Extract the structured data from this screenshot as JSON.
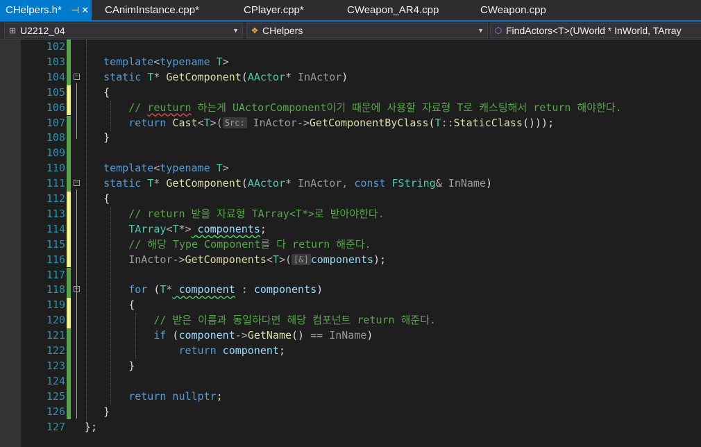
{
  "tabs": [
    {
      "label": "CHelpers.h*",
      "active": true
    },
    {
      "label": "CAnimInstance.cpp*",
      "active": false
    },
    {
      "label": "CPlayer.cpp*",
      "active": false
    },
    {
      "label": "CWeapon_AR4.cpp",
      "active": false
    },
    {
      "label": "CWeapon.cpp",
      "active": false
    }
  ],
  "nav": {
    "project": "U2212_04",
    "scope": "CHelpers",
    "member": "FindActors<T>(UWorld * InWorld, TArray"
  },
  "line_numbers": [
    "102",
    "103",
    "104",
    "105",
    "106",
    "107",
    "108",
    "109",
    "110",
    "111",
    "112",
    "113",
    "114",
    "115",
    "116",
    "117",
    "118",
    "119",
    "120",
    "121",
    "122",
    "123",
    "124",
    "125",
    "126",
    "127"
  ],
  "code": {
    "l103": {
      "kw": "template",
      "lt": "<",
      "kw2": "typename",
      "t": " T",
      "gt": ">"
    },
    "l104": {
      "kw": "static",
      "t": " T",
      "star": "*",
      "fn": " GetComponent",
      "p1": "(",
      "ty": "AActor",
      "star2": "*",
      "pm": " InActor",
      "p2": ")"
    },
    "l105": "{",
    "l106": {
      "pre": "// ",
      "squig": "reuturn",
      "rest": " 하는게 UActorComponent이기 때문에 사용할 자료형 T로 캐스팅해서 return 해야한다."
    },
    "l107": {
      "kw": "return",
      "fn": " Cast",
      "lt": "<",
      "t": "T",
      "gt": ">(",
      "hint": "Src:",
      "pm": " InActor",
      "arrow": "->",
      "fn2": "GetComponentByClass",
      "p": "(",
      "t2": "T",
      "cc": "::",
      "fn3": "StaticClass",
      "end": "()));"
    },
    "l108": "}",
    "l110": {
      "kw": "template",
      "lt": "<",
      "kw2": "typename",
      "t": " T",
      "gt": ">"
    },
    "l111": {
      "kw": "static",
      "t": " T",
      "star": "*",
      "fn": " GetComponent",
      "p1": "(",
      "ty": "AActor",
      "star2": "*",
      "pm": " InActor,",
      "kw3": " const",
      "ty2": " FString",
      "amp": "&",
      "pm2": " InName",
      "p2": ")"
    },
    "l112": "{",
    "l113": "// return 받을 자료형 TArray<T*>로 받아야한다.",
    "l114": {
      "ty": "TArray",
      "lt": "<",
      "t": "T",
      "star": "*",
      "gt": ">",
      "lv": " components",
      "end": ";"
    },
    "l115": "// 해당 Type Component를 다 return 해준다.",
    "l116": {
      "pm": "InActor",
      "arrow": "->",
      "fn": "GetComponents",
      "lt": "<",
      "t": "T",
      "gt": ">(",
      "hint": "[&]",
      "lv": "components",
      "end": ");"
    },
    "l118": {
      "kw": "for",
      "p": " (",
      "t": "T",
      "star": "*",
      "lv": " component",
      "colon": " :",
      "lv2": " components",
      "end": ")"
    },
    "l119": "{",
    "l120": "// 받은 이름과 동일하다면 해당 컴포넌트 return 해준다.",
    "l121": {
      "kw": "if",
      "p": " (",
      "lv": "component",
      "arrow": "->",
      "fn": "GetName",
      "p2": "()",
      "eq": " ==",
      "pm": " InName",
      "end": ")"
    },
    "l122": {
      "kw": "return",
      "lv": " component",
      "end": ";"
    },
    "l123": "}",
    "l125": {
      "kw": "return",
      "kw2": " nullptr",
      "end": ";"
    },
    "l126": "}",
    "l127": "};"
  }
}
